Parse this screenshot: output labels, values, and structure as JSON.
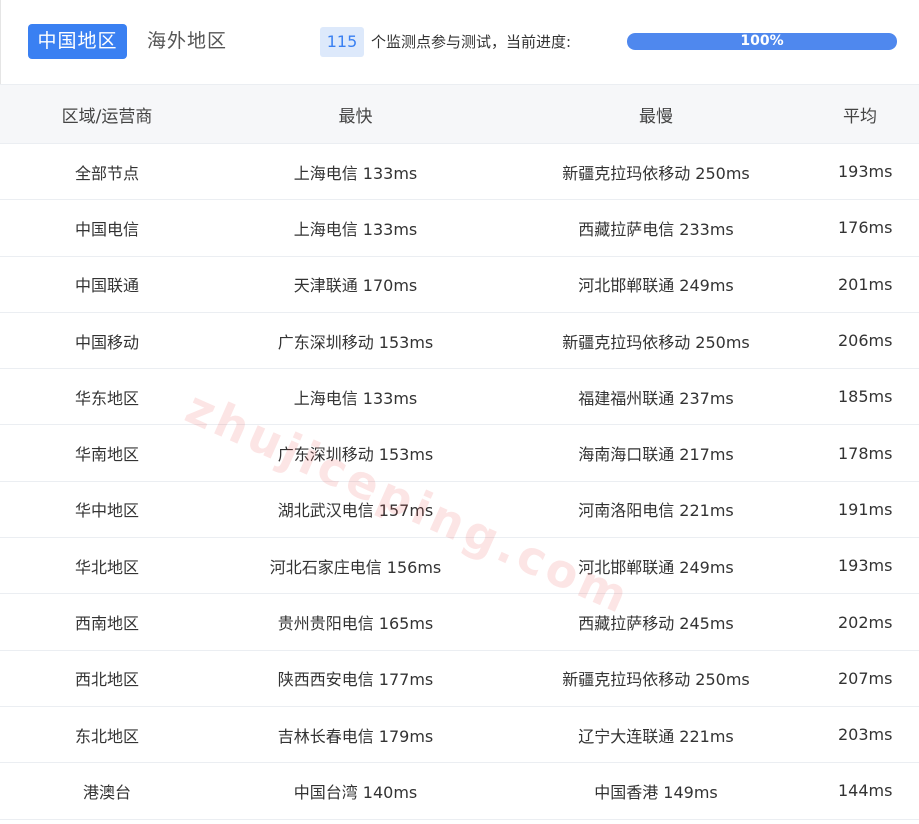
{
  "tabs": {
    "active_label": "中国地区",
    "inactive_label": "海外地区"
  },
  "progress": {
    "count": "115",
    "text": "个监测点参与测试，当前进度:",
    "percent_label": "100%",
    "fraction": 1.0
  },
  "table": {
    "headers": [
      "区域/运营商",
      "最快",
      "最慢",
      "平均"
    ],
    "rows": [
      [
        "全部节点",
        "上海电信 133ms",
        "新疆克拉玛依移动 250ms",
        "193ms"
      ],
      [
        "中国电信",
        "上海电信 133ms",
        "西藏拉萨电信 233ms",
        "176ms"
      ],
      [
        "中国联通",
        "天津联通 170ms",
        "河北邯郸联通 249ms",
        "201ms"
      ],
      [
        "中国移动",
        "广东深圳移动 153ms",
        "新疆克拉玛依移动 250ms",
        "206ms"
      ],
      [
        "华东地区",
        "上海电信 133ms",
        "福建福州联通 237ms",
        "185ms"
      ],
      [
        "华南地区",
        "广东深圳移动 153ms",
        "海南海口联通 217ms",
        "178ms"
      ],
      [
        "华中地区",
        "湖北武汉电信 157ms",
        "河南洛阳电信 221ms",
        "191ms"
      ],
      [
        "华北地区",
        "河北石家庄电信 156ms",
        "河北邯郸联通 249ms",
        "193ms"
      ],
      [
        "西南地区",
        "贵州贵阳电信 165ms",
        "西藏拉萨移动 245ms",
        "202ms"
      ],
      [
        "西北地区",
        "陕西西安电信 177ms",
        "新疆克拉玛依移动 250ms",
        "207ms"
      ],
      [
        "东北地区",
        "吉林长春电信 179ms",
        "辽宁大连联通 221ms",
        "203ms"
      ],
      [
        "港澳台",
        "中国台湾 140ms",
        "中国香港 149ms",
        "144ms"
      ]
    ]
  },
  "watermark": "zhujiceping.com",
  "colors": {
    "accent": "#3a80f2",
    "badge_bg": "#dde9fb",
    "progress_fill": "#4f88ee",
    "header_bg": "#f6f7f9",
    "watermark": "#ec4646"
  }
}
